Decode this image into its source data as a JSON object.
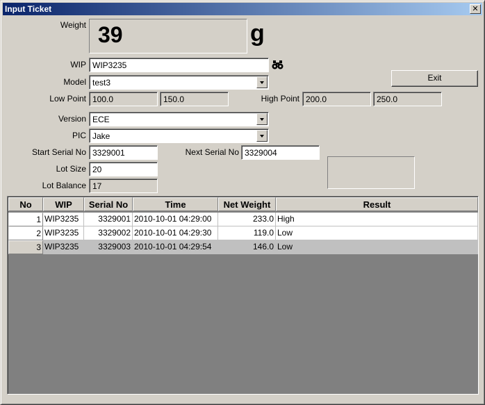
{
  "window": {
    "title": "Input Ticket",
    "close_glyph": "✕"
  },
  "weight": {
    "label": "Weight",
    "value": "39",
    "unit": "g"
  },
  "wip": {
    "label": "WIP",
    "value": "WIP3235",
    "search_icon": "binoculars-icon"
  },
  "model": {
    "label": "Model",
    "value": "test3"
  },
  "points": {
    "low_label": "Low Point",
    "low_1": "100.0",
    "low_2": "150.0",
    "high_label": "High Point",
    "high_1": "200.0",
    "high_2": "250.0"
  },
  "version": {
    "label": "Version",
    "value": "ECE"
  },
  "pic": {
    "label": "PIC",
    "value": "Jake"
  },
  "serial": {
    "start_label": "Start Serial No",
    "start_value": "3329001",
    "next_label": "Next Serial No",
    "next_value": "3329004"
  },
  "lot": {
    "size_label": "Lot Size",
    "size_value": "20",
    "balance_label": "Lot Balance",
    "balance_value": "17"
  },
  "exit_label": "Exit",
  "table": {
    "columns": [
      "No",
      "WIP",
      "Serial No",
      "Time",
      "Net Weight",
      "Result"
    ],
    "rows": [
      {
        "no": "1",
        "wip": "WIP3235",
        "serial": "3329001",
        "time": "2010-10-01 04:29:00",
        "net_weight": "233.0",
        "result": "High"
      },
      {
        "no": "2",
        "wip": "WIP3235",
        "serial": "3329002",
        "time": "2010-10-01 04:29:30",
        "net_weight": "119.0",
        "result": "Low"
      },
      {
        "no": "3",
        "wip": "WIP3235",
        "serial": "3329003",
        "time": "2010-10-01 04:29:54",
        "net_weight": "146.0",
        "result": "Low"
      }
    ],
    "selected_row": 3
  }
}
